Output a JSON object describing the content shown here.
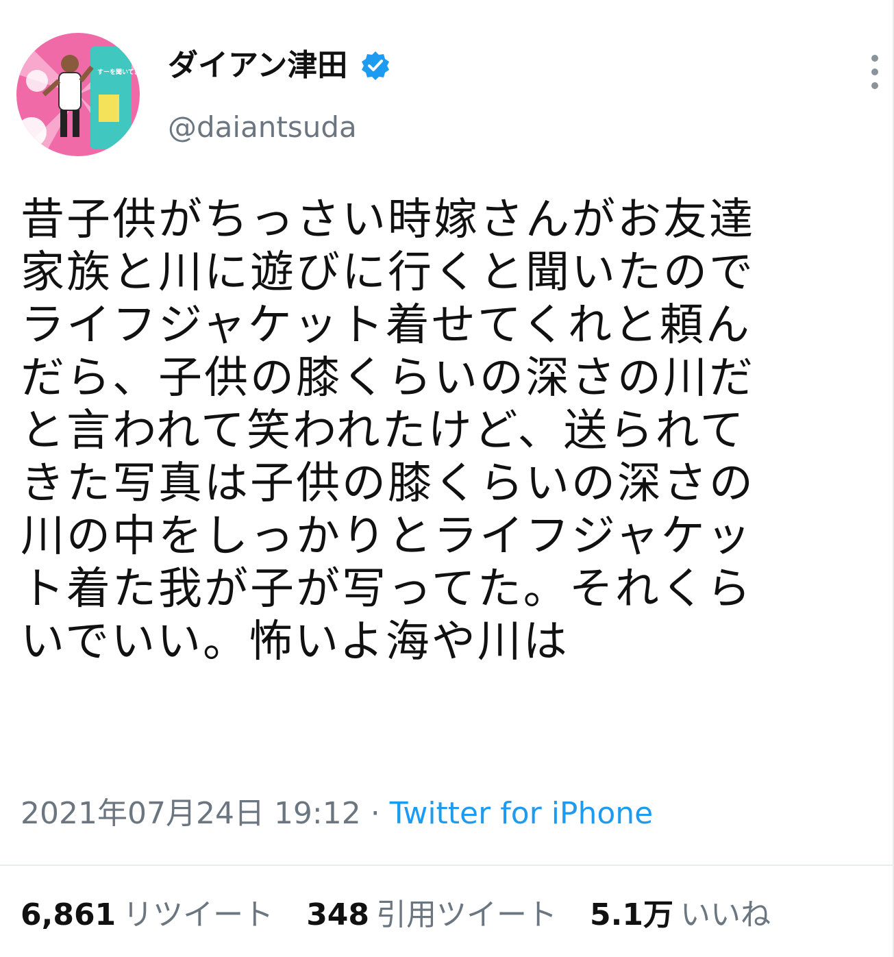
{
  "user": {
    "display_name": "ダイアン津田",
    "handle": "@daiantsuda",
    "verified": true,
    "avatar_text": "すーを聞いてます"
  },
  "tweet": {
    "lines": [
      "昔子供がちっさい時嫁さんがお友達",
      "家族と川に遊びに行くと聞いたので",
      "ライフジャケット着せてくれと頼ん",
      "だら、子供の膝くらいの深さの川だ",
      "と言われて笑われたけど、送られて",
      "きた写真は子供の膝くらいの深さの",
      "川の中をしっかりとライフジャケッ",
      "ト着た我が子が写ってた。それくら",
      "いでいい。怖いよ海や川は"
    ],
    "timestamp": "2021年07月24日 19:12",
    "separator": "·",
    "source": "Twitter for iPhone"
  },
  "stats": {
    "retweets": {
      "count": "6,861",
      "label": "リツイート"
    },
    "quotes": {
      "count": "348",
      "label": "引用ツイート"
    },
    "likes": {
      "count": "5.1万",
      "label": "いいね"
    }
  },
  "colors": {
    "link": "#1d9bf0",
    "muted": "#6b7680",
    "verified_badge": "#1d9bf0"
  }
}
